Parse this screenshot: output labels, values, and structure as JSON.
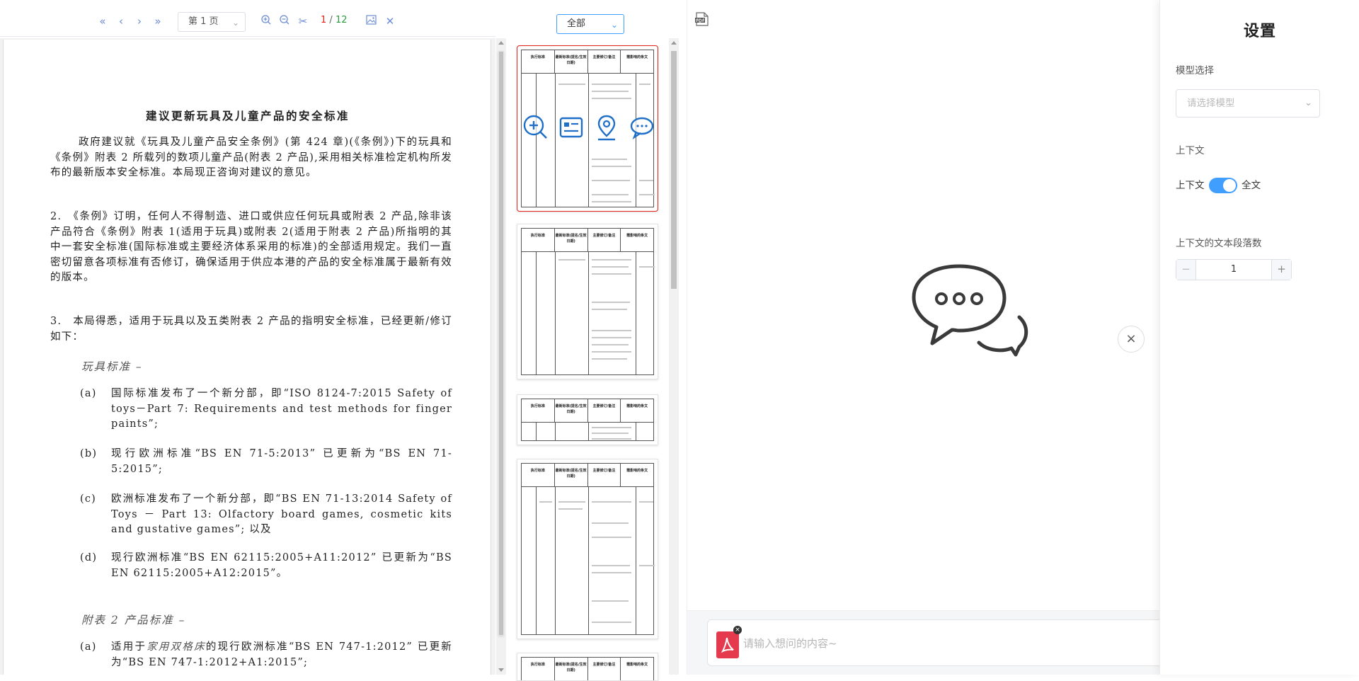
{
  "toolbar": {
    "page_select_value": "第 1 页",
    "page_current": "1",
    "page_sep": " / ",
    "page_total": "12",
    "icons": [
      "first-page-icon",
      "prev-page-icon",
      "next-page-icon",
      "last-page-icon",
      "zoom-in-icon",
      "zoom-out-icon",
      "cut-icon",
      "image-icon",
      "close-icon"
    ]
  },
  "document": {
    "title": "建议更新玩具及儿童产品的安全标准",
    "para1": "政府建议就《玩具及儿童产品安全条例》(第 424 章)(《条例》)下的玩具和《条例》附表 2 所载列的数项儿童产品(附表 2 产品),采用相关标准检定机构所发布的最新版本安全标准。本局现正咨询对建议的意见。",
    "para2": "2.　《条例》订明，任何人不得制造、进口或供应任何玩具或附表 2 产品,除非该产品符合《条例》附表 1(适用于玩具)或附表 2(适用于附表 2 产品)所指明的其中一套安全标准(国际标准或主要经济体系采用的标准)的全部适用规定。我们一直密切留意各项标准有否修订，确保适用于供应本港的产品的安全标准属于最新有效的版本。",
    "para3": "3.　本局得悉，适用于玩具以及五类附表 2 产品的指明安全标准，已经更新/修订如下：",
    "subhead1": "玩具标准 –",
    "items1": [
      {
        "label": "(a)",
        "text": "国际标准发布了一个新分部，即“ISO 8124-7:2015 Safety of toys－Part 7: Requirements and test methods for finger paints”;"
      },
      {
        "label": "(b)",
        "text": "现行欧洲标准“BS EN 71-5:2013” 已更新为“BS EN 71-5:2015”;"
      },
      {
        "label": "(c)",
        "text": "欧洲标准发布了一个新分部，即“BS EN 71-13:2014 Safety of Toys － Part 13: Olfactory board games, cosmetic kits and gustative games”; 以及"
      },
      {
        "label": "(d)",
        "text": "现行欧洲标准“BS EN 62115:2005+A11:2012” 已更新为“BS EN 62115:2005+A12:2015”。"
      }
    ],
    "subhead2": "附表 2 产品标准 –",
    "items2": [
      {
        "label": "(a)",
        "text_pre": "适用于",
        "text_em": "家用双格床",
        "text_post": "的现行欧洲标准“BS EN 747-1:2012” 已更新为“BS EN 747-1:2012+A1:2015”;"
      }
    ]
  },
  "thumbs": {
    "filter_value": "全部",
    "headers": [
      "执行标准",
      "最新标准(提名/生效日期)",
      "主要修订/备注",
      "需影响的条文"
    ]
  },
  "chat": {
    "input_placeholder": "请输入想问的内容~",
    "close_symbol": "×",
    "file_remove_symbol": "×"
  },
  "settings": {
    "title": "设置",
    "model_label": "模型选择",
    "model_placeholder": "请选择模型",
    "context_label": "上下文",
    "context_toggle_left": "上下文",
    "context_toggle_right": "全文",
    "context_toggle_on": true,
    "paragraphs_label": "上下文的文本段落数",
    "paragraphs_value": "1",
    "minus": "−",
    "plus": "+"
  },
  "colors": {
    "accent": "#409eff",
    "toolbar_icon": "#6b8cd6",
    "active_thumb_border": "#e2231a",
    "page_current": "#e2231a",
    "page_total": "#2a9d3d",
    "pdf_chip": "#e53a4e"
  }
}
